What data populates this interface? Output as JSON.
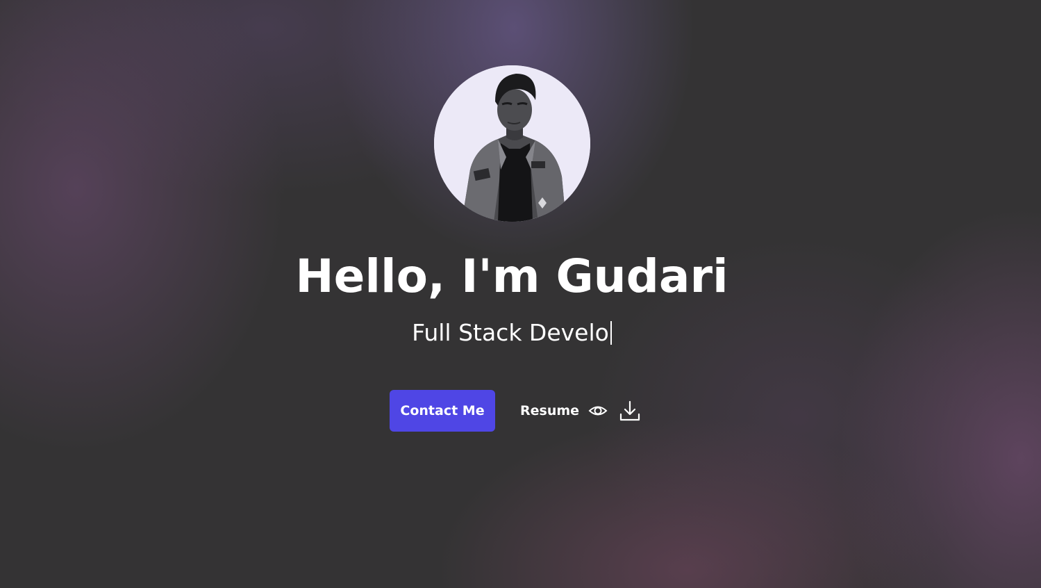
{
  "hero": {
    "greeting": "Hello, I'm Gudari",
    "typed_role": "Full Stack Develo",
    "avatar_alt": "Profile photo"
  },
  "actions": {
    "contact_label": "Contact Me",
    "resume_label": "Resume",
    "view_icon": "eye-icon",
    "download_icon": "download-icon"
  },
  "colors": {
    "background": "#343334",
    "accent": "#4f46e5",
    "text": "#ffffff",
    "avatar_bg": "#ece9f7"
  }
}
